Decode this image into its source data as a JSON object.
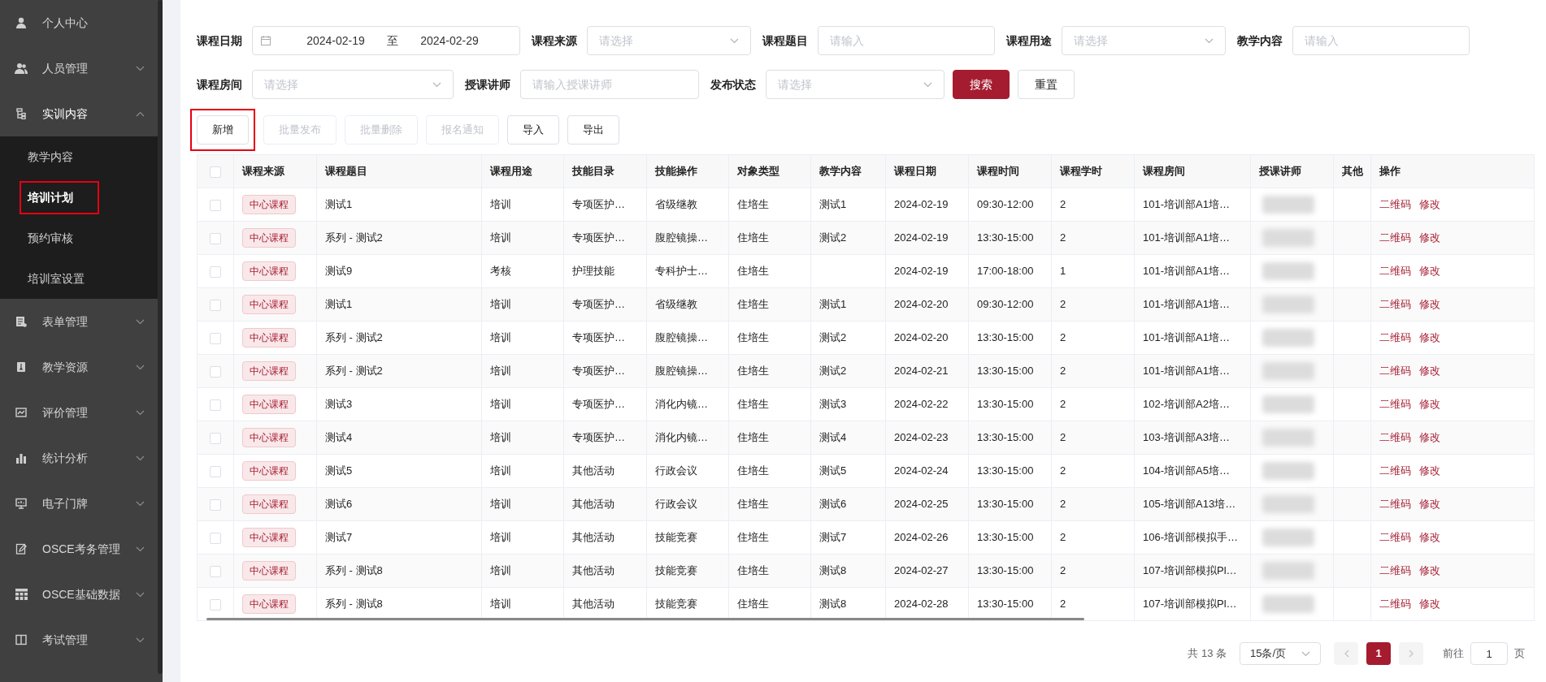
{
  "sidebar": {
    "items": [
      {
        "label": "个人中心",
        "expandable": false,
        "expanded": false
      },
      {
        "label": "人员管理",
        "expandable": true,
        "expanded": false
      },
      {
        "label": "实训内容",
        "expandable": true,
        "expanded": true,
        "children": [
          {
            "label": "教学内容",
            "selected": false,
            "highlighted": false
          },
          {
            "label": "培训计划",
            "selected": true,
            "highlighted": true
          },
          {
            "label": "预约审核",
            "selected": false,
            "highlighted": false
          },
          {
            "label": "培训室设置",
            "selected": false,
            "highlighted": false
          }
        ]
      },
      {
        "label": "表单管理",
        "expandable": true,
        "expanded": false
      },
      {
        "label": "教学资源",
        "expandable": true,
        "expanded": false
      },
      {
        "label": "评价管理",
        "expandable": true,
        "expanded": false
      },
      {
        "label": "统计分析",
        "expandable": true,
        "expanded": false
      },
      {
        "label": "电子门牌",
        "expandable": true,
        "expanded": false
      },
      {
        "label": "OSCE考务管理",
        "expandable": true,
        "expanded": false
      },
      {
        "label": "OSCE基础数据",
        "expandable": true,
        "expanded": false
      },
      {
        "label": "考试管理",
        "expandable": true,
        "expanded": false
      }
    ]
  },
  "filters": {
    "rows": [
      [
        {
          "label": "课程日期",
          "kind": "daterange",
          "start": "2024-02-19",
          "separator": "至",
          "end": "2024-02-29"
        },
        {
          "label": "课程来源",
          "kind": "select",
          "placeholder": "请选择"
        },
        {
          "label": "课程题目",
          "kind": "input",
          "placeholder": "请输入"
        },
        {
          "label": "课程用途",
          "kind": "select",
          "placeholder": "请选择"
        },
        {
          "label": "教学内容",
          "kind": "input",
          "placeholder": "请输入"
        }
      ],
      [
        {
          "label": "课程房间",
          "kind": "select",
          "placeholder": "请选择"
        },
        {
          "label": "授课讲师",
          "kind": "input",
          "placeholder": "请输入授课讲师"
        },
        {
          "label": "发布状态",
          "kind": "select",
          "placeholder": "请选择"
        }
      ]
    ],
    "buttons": [
      {
        "label": "搜索",
        "primary": true
      },
      {
        "label": "重置",
        "primary": false
      }
    ]
  },
  "toolbar": [
    {
      "label": "新增",
      "disabled": false,
      "highlighted": true
    },
    {
      "label": "批量发布",
      "disabled": true,
      "highlighted": false
    },
    {
      "label": "批量删除",
      "disabled": true,
      "highlighted": false
    },
    {
      "label": "报名通知",
      "disabled": true,
      "highlighted": false
    },
    {
      "label": "导入",
      "disabled": false,
      "highlighted": false
    },
    {
      "label": "导出",
      "disabled": false,
      "highlighted": false
    }
  ],
  "table": {
    "all_checked": false,
    "columns": [
      "课程来源",
      "课程题目",
      "课程用途",
      "技能目录",
      "技能操作",
      "对象类型",
      "教学内容",
      "课程日期",
      "课程时间",
      "课程学时",
      "课程房间",
      "授课讲师",
      "其他",
      "操作"
    ],
    "rows": [
      {
        "checked": false,
        "cells": [
          "中心课程",
          "测试1",
          "培训",
          "专项医护…",
          "省级继教",
          "住培生",
          "测试1",
          "2024-02-19",
          "09:30-12:00",
          "2",
          "101-培训部A1培…"
        ],
        "actions": [
          "二维码",
          "修改"
        ]
      },
      {
        "checked": false,
        "cells": [
          "中心课程",
          "系列 - 测试2",
          "培训",
          "专项医护…",
          "腹腔镜操…",
          "住培生",
          "测试2",
          "2024-02-19",
          "13:30-15:00",
          "2",
          "101-培训部A1培…"
        ],
        "actions": [
          "二维码",
          "修改"
        ]
      },
      {
        "checked": false,
        "cells": [
          "中心课程",
          "测试9",
          "考核",
          "护理技能",
          "专科护士…",
          "住培生",
          "",
          "2024-02-19",
          "17:00-18:00",
          "1",
          "101-培训部A1培…"
        ],
        "actions": [
          "二维码",
          "修改"
        ]
      },
      {
        "checked": false,
        "cells": [
          "中心课程",
          "测试1",
          "培训",
          "专项医护…",
          "省级继教",
          "住培生",
          "测试1",
          "2024-02-20",
          "09:30-12:00",
          "2",
          "101-培训部A1培…"
        ],
        "actions": [
          "二维码",
          "修改"
        ]
      },
      {
        "checked": false,
        "cells": [
          "中心课程",
          "系列 - 测试2",
          "培训",
          "专项医护…",
          "腹腔镜操…",
          "住培生",
          "测试2",
          "2024-02-20",
          "13:30-15:00",
          "2",
          "101-培训部A1培…"
        ],
        "actions": [
          "二维码",
          "修改"
        ]
      },
      {
        "checked": false,
        "cells": [
          "中心课程",
          "系列 - 测试2",
          "培训",
          "专项医护…",
          "腹腔镜操…",
          "住培生",
          "测试2",
          "2024-02-21",
          "13:30-15:00",
          "2",
          "101-培训部A1培…"
        ],
        "actions": [
          "二维码",
          "修改"
        ]
      },
      {
        "checked": false,
        "cells": [
          "中心课程",
          "测试3",
          "培训",
          "专项医护…",
          "消化内镜…",
          "住培生",
          "测试3",
          "2024-02-22",
          "13:30-15:00",
          "2",
          "102-培训部A2培…"
        ],
        "actions": [
          "二维码",
          "修改"
        ]
      },
      {
        "checked": false,
        "cells": [
          "中心课程",
          "测试4",
          "培训",
          "专项医护…",
          "消化内镜…",
          "住培生",
          "测试4",
          "2024-02-23",
          "13:30-15:00",
          "2",
          "103-培训部A3培…"
        ],
        "actions": [
          "二维码",
          "修改"
        ]
      },
      {
        "checked": false,
        "cells": [
          "中心课程",
          "测试5",
          "培训",
          "其他活动",
          "行政会议",
          "住培生",
          "测试5",
          "2024-02-24",
          "13:30-15:00",
          "2",
          "104-培训部A5培…"
        ],
        "actions": [
          "二维码",
          "修改"
        ]
      },
      {
        "checked": false,
        "cells": [
          "中心课程",
          "测试6",
          "培训",
          "其他活动",
          "行政会议",
          "住培生",
          "测试6",
          "2024-02-25",
          "13:30-15:00",
          "2",
          "105-培训部A13培…"
        ],
        "actions": [
          "二维码",
          "修改"
        ]
      },
      {
        "checked": false,
        "cells": [
          "中心课程",
          "测试7",
          "培训",
          "其他活动",
          "技能竞赛",
          "住培生",
          "测试7",
          "2024-02-26",
          "13:30-15:00",
          "2",
          "106-培训部模拟手…"
        ],
        "actions": [
          "二维码",
          "修改"
        ]
      },
      {
        "checked": false,
        "cells": [
          "中心课程",
          "系列 - 测试8",
          "培训",
          "其他活动",
          "技能竞赛",
          "住培生",
          "测试8",
          "2024-02-27",
          "13:30-15:00",
          "2",
          "107-培训部模拟Pl…"
        ],
        "actions": [
          "二维码",
          "修改"
        ]
      },
      {
        "checked": false,
        "cells": [
          "中心课程",
          "系列 - 测试8",
          "培训",
          "其他活动",
          "技能竞赛",
          "住培生",
          "测试8",
          "2024-02-28",
          "13:30-15:00",
          "2",
          "107-培训部模拟Pl…"
        ],
        "actions": [
          "二维码",
          "修改"
        ]
      }
    ]
  },
  "pagination": {
    "total": "共 13 条",
    "page_size": "15条/页",
    "pages": [
      {
        "label": "1",
        "selected": true
      }
    ],
    "goto_label": "前往",
    "goto_value": "1",
    "goto_suffix": "页"
  }
}
